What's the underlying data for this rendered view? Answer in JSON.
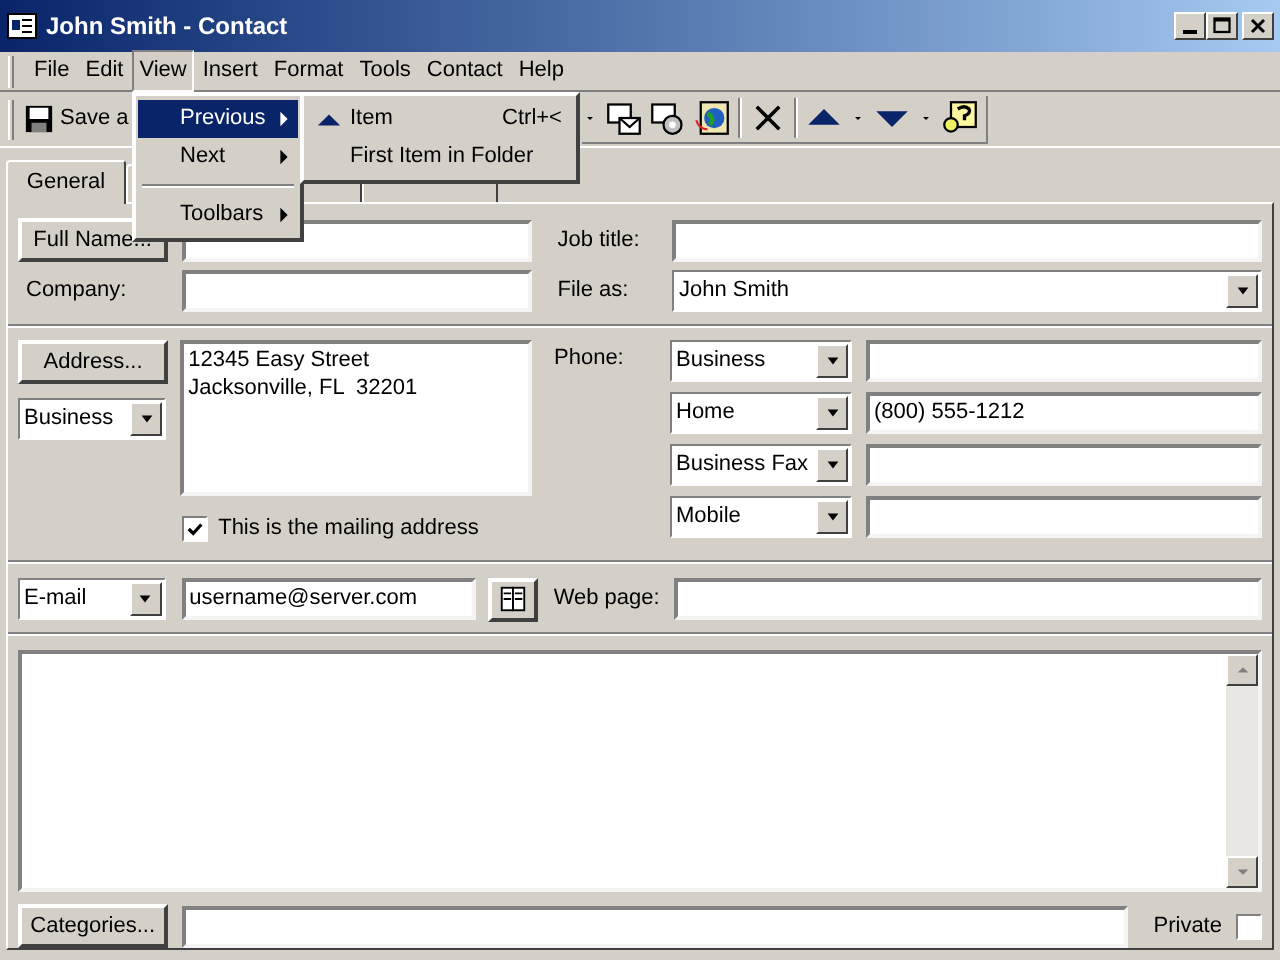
{
  "window": {
    "title": "John Smith - Contact"
  },
  "menu_bar": [
    {
      "label": "File",
      "selected": false
    },
    {
      "label": "Edit",
      "selected": false
    },
    {
      "label": "View",
      "selected": true
    },
    {
      "label": "Insert",
      "selected": false
    },
    {
      "label": "Format",
      "selected": false
    },
    {
      "label": "Tools",
      "selected": false
    },
    {
      "label": "Contact",
      "selected": false
    },
    {
      "label": "Help",
      "selected": false
    }
  ],
  "toolbar": {
    "save_label": "Save a"
  },
  "view_menu": [
    {
      "kind": "item",
      "label": "Previous",
      "selected": true
    },
    {
      "kind": "item",
      "label": "Next",
      "selected": false
    },
    {
      "kind": "separator"
    },
    {
      "kind": "item",
      "label": "Toolbars",
      "selected": false
    }
  ],
  "submenu": [
    {
      "kind": "icon_item",
      "label": "Item",
      "shortcut": "Ctrl+<"
    },
    {
      "kind": "item",
      "label": "First Item in Folder"
    }
  ],
  "tabs": [
    {
      "label": "General",
      "selected": true
    },
    {
      "selected": false
    },
    {
      "selected": false
    }
  ],
  "form": {
    "full_name_button": "Full Name...",
    "job_title_label": "Job title:",
    "company_label": "Company:",
    "file_as_label": "File as:",
    "file_as_value": "John Smith",
    "address_button": "Address...",
    "address_type": "Business",
    "address_lines": [
      "12345 Easy Street",
      "Jacksonville, FL  32201"
    ],
    "mailing": {
      "label": "This is the mailing address",
      "checked": true
    },
    "phone_label": "Phone:",
    "phones": [
      {
        "type": "Business"
      },
      {
        "type": "Home",
        "value": "(800) 555-1212"
      },
      {
        "type": "Business Fax"
      },
      {
        "type": "Mobile"
      }
    ],
    "email_type": "E-mail",
    "email": "username@server.com",
    "web_page_label": "Web page:",
    "categories_button": "Categories...",
    "private": {
      "label": "Private",
      "checked": false
    }
  }
}
